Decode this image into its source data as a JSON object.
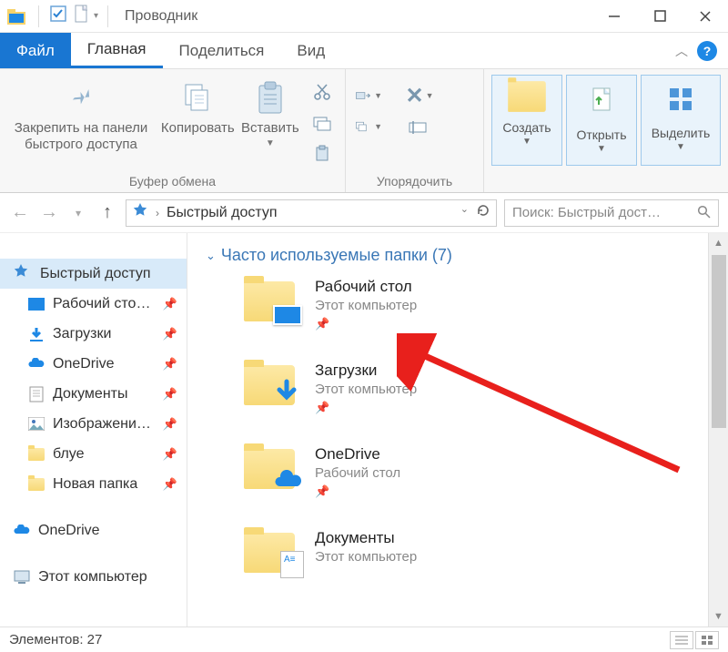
{
  "title": "Проводник",
  "tabs": {
    "file": "Файл",
    "home": "Главная",
    "share": "Поделиться",
    "view": "Вид"
  },
  "ribbon": {
    "pin": "Закрепить на панели быстрого доступа",
    "copy": "Копировать",
    "paste": "Вставить",
    "clipboard_group": "Буфер обмена",
    "organize_group": "Упорядочить",
    "create": "Создать",
    "open": "Открыть",
    "select": "Выделить"
  },
  "address": {
    "root": "Быстрый доступ"
  },
  "search": {
    "placeholder": "Поиск: Быстрый дост…"
  },
  "sidebar": {
    "quick": "Быстрый доступ",
    "items": [
      {
        "label": "Рабочий сто…"
      },
      {
        "label": "Загрузки"
      },
      {
        "label": "OneDrive"
      },
      {
        "label": "Документы"
      },
      {
        "label": "Изображени…"
      },
      {
        "label": "блуе"
      },
      {
        "label": "Новая папка"
      }
    ],
    "onedrive": "OneDrive",
    "thispc": "Этот компьютер"
  },
  "section": {
    "title": "Часто используемые папки (7)"
  },
  "folders": [
    {
      "name": "Рабочий стол",
      "sub": "Этот компьютер"
    },
    {
      "name": "Загрузки",
      "sub": "Этот компьютер"
    },
    {
      "name": "OneDrive",
      "sub": "Рабочий стол"
    },
    {
      "name": "Документы",
      "sub": "Этот компьютер"
    }
  ],
  "status": {
    "count_label": "Элементов:",
    "count": "27"
  }
}
